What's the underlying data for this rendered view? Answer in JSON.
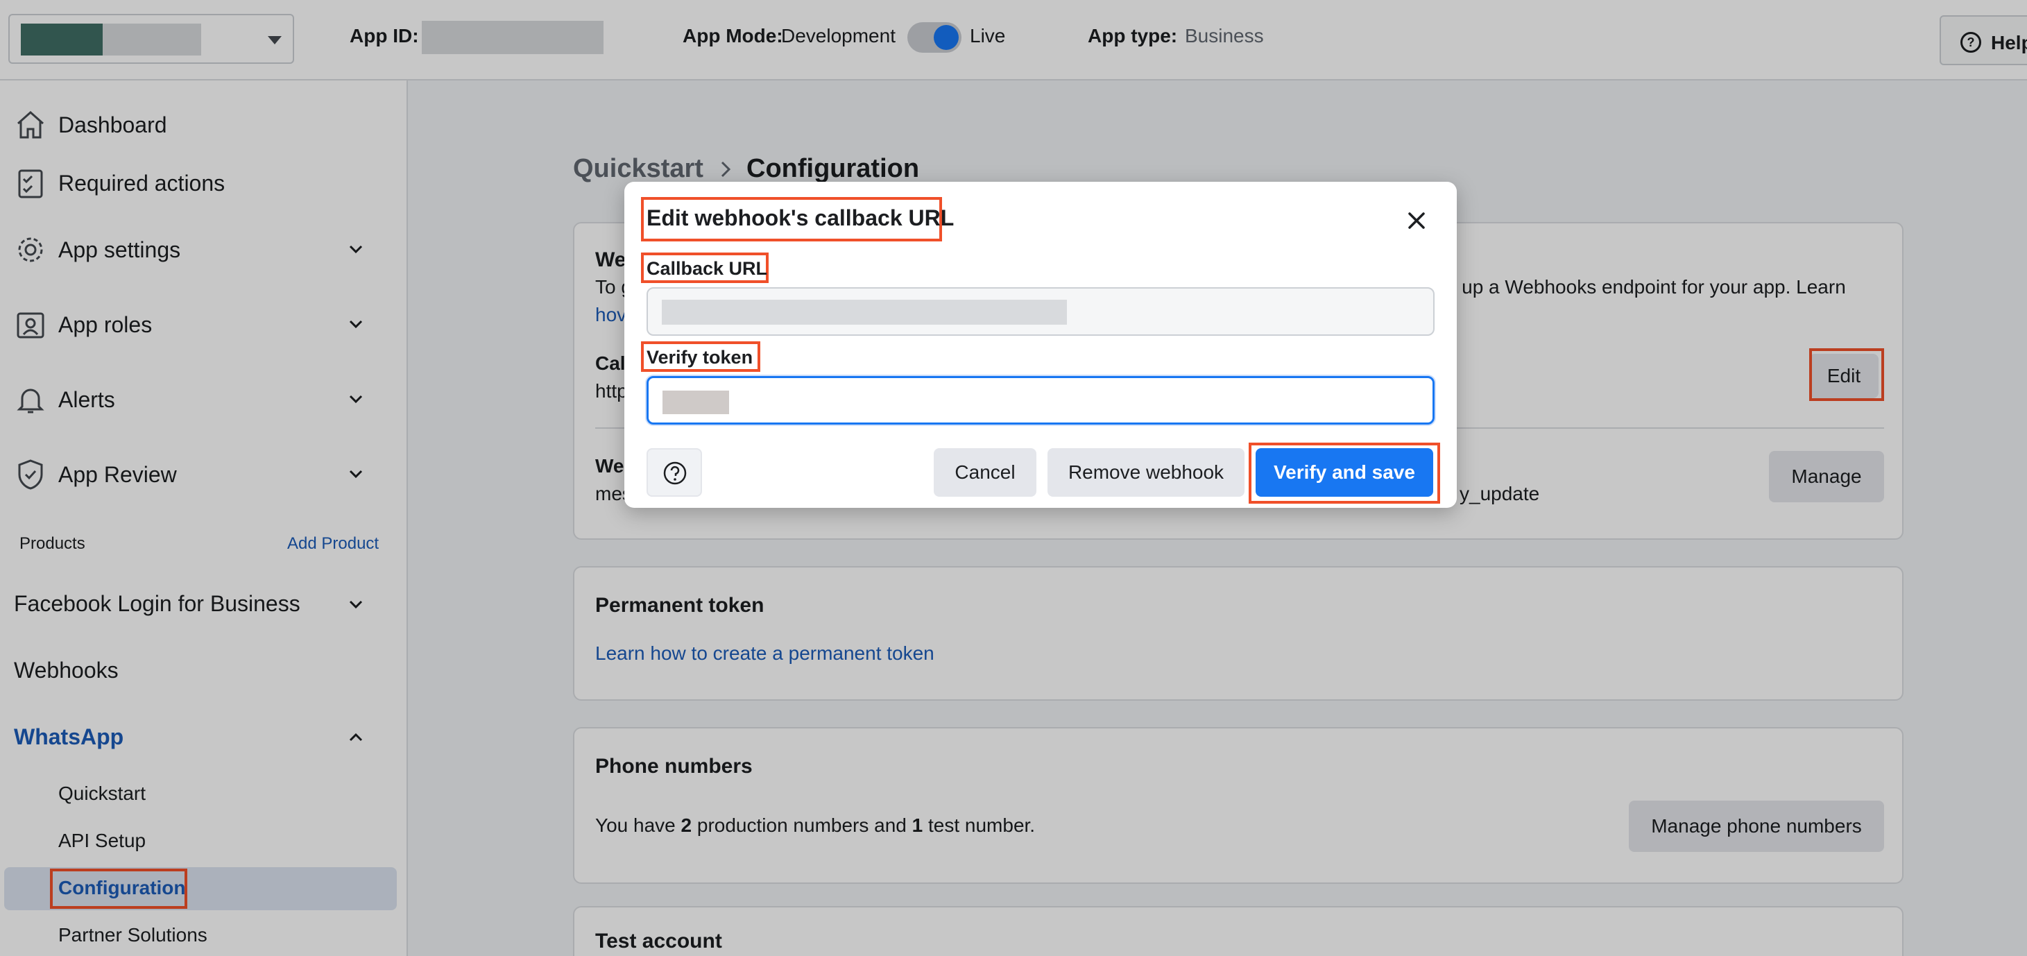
{
  "topbar": {
    "app_id_label": "App ID:",
    "app_mode_label": "App Mode:",
    "mode_development": "Development",
    "mode_live": "Live",
    "app_type_label": "App type:",
    "app_type_value": "Business",
    "help_label": "Help"
  },
  "sidebar": {
    "dashboard": "Dashboard",
    "required_actions": "Required actions",
    "app_settings": "App settings",
    "app_roles": "App roles",
    "alerts": "Alerts",
    "app_review": "App Review",
    "products_label": "Products",
    "add_product": "Add Product",
    "facebook_login": "Facebook Login for Business",
    "webhooks": "Webhooks",
    "whatsapp": "WhatsApp",
    "quickstart": "Quickstart",
    "api_setup": "API Setup",
    "configuration": "Configuration",
    "partner_solutions": "Partner Solutions"
  },
  "main": {
    "breadcrumb_parent": "Quickstart",
    "breadcrumb_current": "Configuration",
    "webhook_card": {
      "title_fragment": "We",
      "desc_fragment_left": "To g",
      "desc_fragment_right": "et up a Webhooks endpoint for your app. Learn",
      "link_fragment": "hov",
      "callback_fragment": "Cal",
      "url_fragment": "http",
      "edit_label": "Edit",
      "fields_fragment": "Wel",
      "fields_value_left": "mes",
      "fields_value_right": "y_update",
      "manage_label": "Manage"
    },
    "permanent_token": {
      "title": "Permanent token",
      "link": "Learn how to create a permanent token"
    },
    "phone_numbers": {
      "title": "Phone numbers",
      "text_1": "You have ",
      "count_production": "2",
      "text_2": " production numbers and ",
      "count_test": "1",
      "text_3": " test number.",
      "manage_label": "Manage phone numbers"
    },
    "test_account": {
      "title": "Test account"
    }
  },
  "modal": {
    "title": "Edit webhook's callback URL",
    "callback_label": "Callback URL",
    "verify_label": "Verify token",
    "cancel_label": "Cancel",
    "remove_label": "Remove webhook",
    "save_label": "Verify and save"
  },
  "colors": {
    "accent": "#1877f2",
    "highlight": "#f0502a",
    "link": "#1b5bb8"
  }
}
